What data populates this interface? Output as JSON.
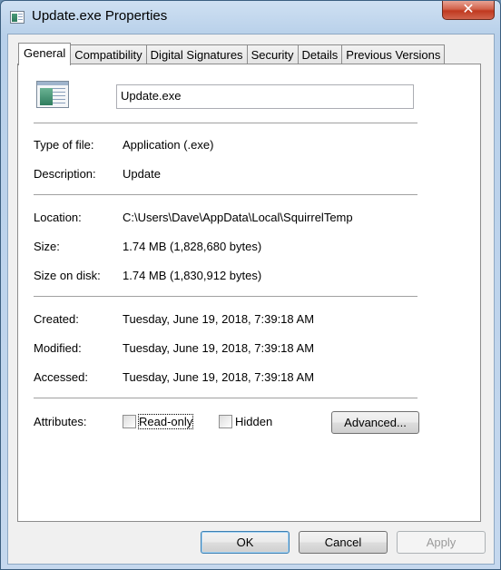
{
  "window": {
    "title": "Update.exe Properties",
    "close_glyph": "✕"
  },
  "tabs": [
    {
      "label": "General",
      "active": true
    },
    {
      "label": "Compatibility"
    },
    {
      "label": "Digital Signatures"
    },
    {
      "label": "Security"
    },
    {
      "label": "Details"
    },
    {
      "label": "Previous Versions"
    }
  ],
  "general": {
    "file_name": "Update.exe",
    "type_of_file": {
      "label": "Type of file:",
      "value": "Application (.exe)"
    },
    "description": {
      "label": "Description:",
      "value": "Update"
    },
    "location": {
      "label": "Location:",
      "value": "C:\\Users\\Dave\\AppData\\Local\\SquirrelTemp"
    },
    "size": {
      "label": "Size:",
      "value": "1.74 MB (1,828,680 bytes)"
    },
    "size_on_disk": {
      "label": "Size on disk:",
      "value": "1.74 MB (1,830,912 bytes)"
    },
    "created": {
      "label": "Created:",
      "value": "Tuesday, June 19, 2018, 7:39:18 AM"
    },
    "modified": {
      "label": "Modified:",
      "value": "Tuesday, June 19, 2018, 7:39:18 AM"
    },
    "accessed": {
      "label": "Accessed:",
      "value": "Tuesday, June 19, 2018, 7:39:18 AM"
    },
    "attributes": {
      "label": "Attributes:",
      "read_only": {
        "label": "Read-only",
        "checked": false
      },
      "hidden": {
        "label": "Hidden",
        "checked": false
      },
      "advanced_label": "Advanced..."
    }
  },
  "buttons": {
    "ok": "OK",
    "cancel": "Cancel",
    "apply": "Apply"
  }
}
